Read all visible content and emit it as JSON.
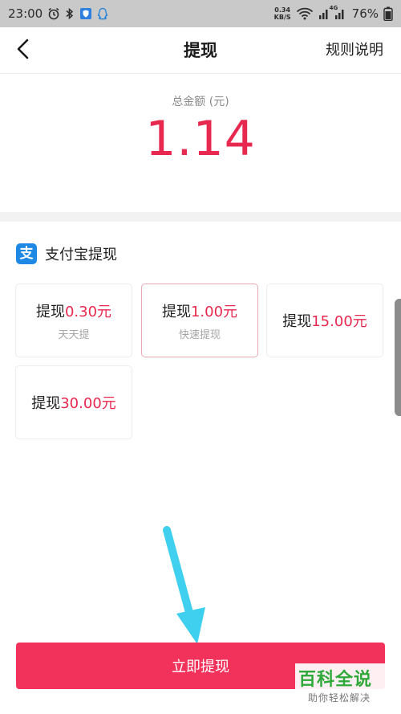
{
  "status_bar": {
    "time": "23:00",
    "net_speed_value": "0.34",
    "net_speed_unit": "KB/S",
    "signal_label": "4G",
    "battery": "76%"
  },
  "nav": {
    "title": "提现",
    "rules_label": "规则说明"
  },
  "balance": {
    "label": "总金额 (元)",
    "value": "1.14"
  },
  "method": {
    "title": "支付宝提现",
    "icon_glyph": "支"
  },
  "options": [
    {
      "prefix": "提现",
      "amount": "0.30元",
      "note": "天天提",
      "selected": false
    },
    {
      "prefix": "提现",
      "amount": "1.00元",
      "note": "快速提现",
      "selected": true
    },
    {
      "prefix": "提现",
      "amount": "15.00元",
      "note": "",
      "selected": false
    },
    {
      "prefix": "提现",
      "amount": "30.00元",
      "note": "",
      "selected": false
    }
  ],
  "submit_label": "立即提现",
  "watermark": {
    "title": "百科全说",
    "subtitle": "助你轻松解决"
  },
  "colors": {
    "accent": "#e8294f",
    "button": "#f2325a",
    "alipay": "#1e88e5",
    "arrow": "#3fd0f0"
  }
}
